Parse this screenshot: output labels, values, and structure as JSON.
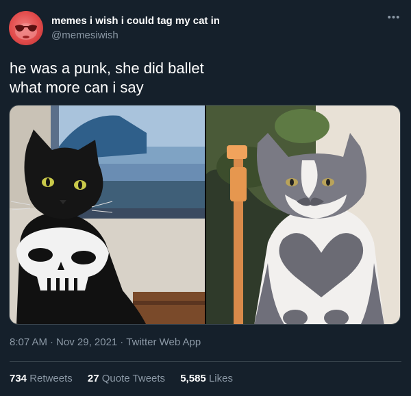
{
  "user": {
    "display_name": "memes i wish i could tag my cat in",
    "handle": "@memesiwish"
  },
  "tweet": {
    "lines": [
      "he was a punk, she did ballet",
      "what more can i say"
    ]
  },
  "media": {
    "left_image": "black-cat-with-skull-marking-photo",
    "right_image": "grey-white-cat-with-heart-marking-photo"
  },
  "meta": {
    "time": "8:07 AM",
    "date": "Nov 29, 2021",
    "source": "Twitter Web App",
    "separator": "·"
  },
  "stats": {
    "retweets": {
      "count": "734",
      "label": "Retweets"
    },
    "quote_tweets": {
      "count": "27",
      "label": "Quote Tweets"
    },
    "likes": {
      "count": "5,585",
      "label": "Likes"
    }
  },
  "icons": {
    "more": "more-horizontal-icon"
  },
  "colors": {
    "background": "#15202b",
    "secondary_text": "#8b98a5",
    "divider": "#38444d",
    "avatar": "#e14b4b"
  }
}
